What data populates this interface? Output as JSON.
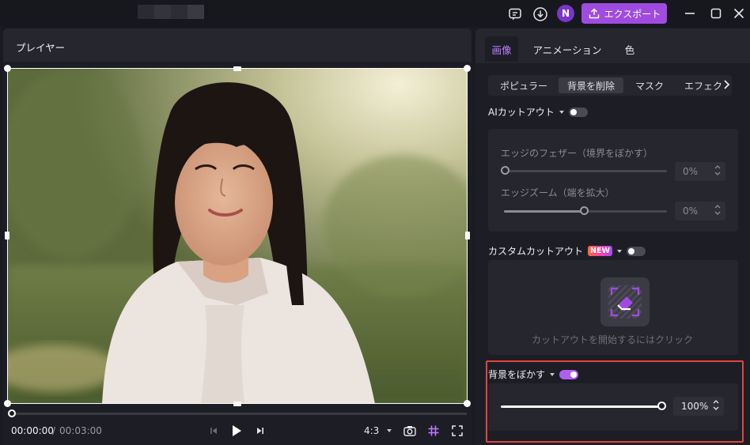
{
  "titlebar": {
    "avatar_initial": "N",
    "export_label": "エクスポート",
    "icons": [
      "feedback-icon",
      "download-icon",
      "export-upload-icon",
      "minimize-icon",
      "maximize-icon",
      "close-icon"
    ]
  },
  "player": {
    "title": "プレイヤー",
    "current_time": "00:00:00",
    "separator": "/",
    "total_time": "00:03:00",
    "progress": 0,
    "aspect_ratio": "4:3"
  },
  "right_panel": {
    "tabs": [
      "画像",
      "アニメーション",
      "色"
    ],
    "active_tab": "画像",
    "subtabs": [
      "ポピュラー",
      "背景を削除",
      "マスク",
      "エフェク"
    ],
    "active_subtab": "背景を削除",
    "ai_cutout": {
      "label": "AIカットアウト",
      "enabled": false,
      "edge_feather": {
        "label": "エッジのフェザー（境界をぼかす）",
        "value": 0,
        "display": "0%"
      },
      "edge_zoom": {
        "label": "エッジズーム（端を拡大）",
        "value": 0.5,
        "display": "0%"
      }
    },
    "custom_cutout": {
      "label": "カスタムカットアウト",
      "badge": "NEW",
      "enabled": false,
      "hint": "カットアウトを開始するにはクリック"
    },
    "blur_background": {
      "label": "背景をぼかす",
      "enabled": true,
      "value": 100,
      "display": "100%"
    }
  },
  "colors": {
    "accent": "#a04be0",
    "toggle_on": "#b05ef0",
    "highlight": "#e2453c"
  }
}
